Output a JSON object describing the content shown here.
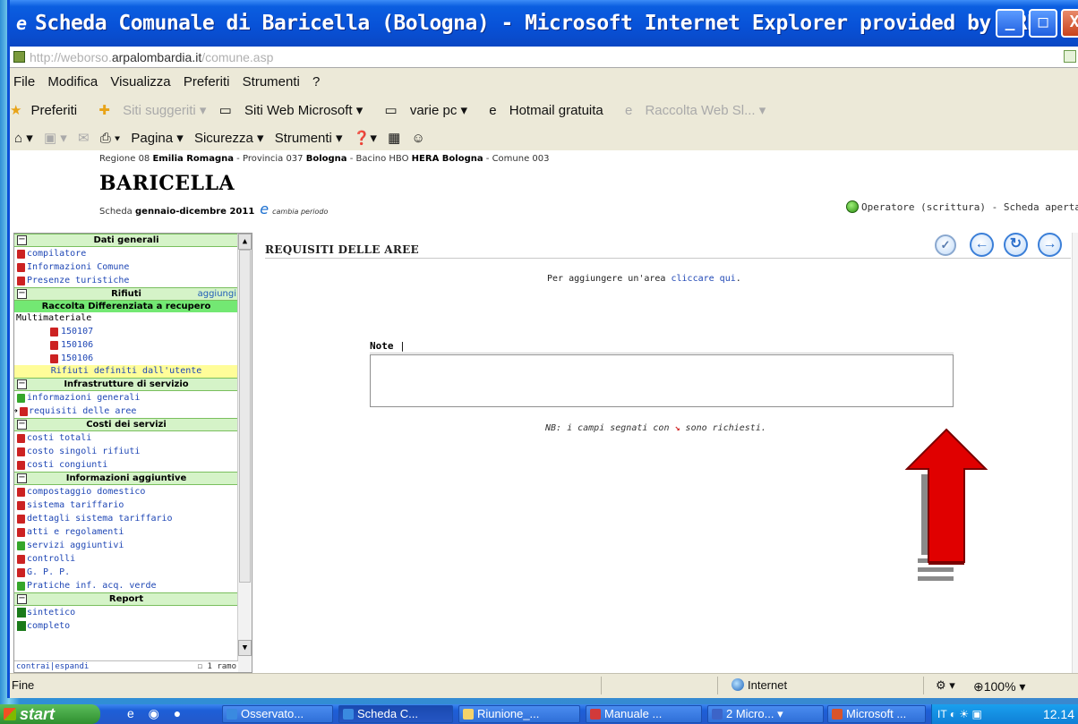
{
  "window": {
    "title": "Scheda Comunale di Baricella (Bologna) - Microsoft Internet Explorer provided by ARPA",
    "min_label": "_",
    "max_label": "□",
    "close_label": "X"
  },
  "address": {
    "url_prefix": "http://weborso.",
    "url_domain": "arpalombardia.it",
    "url_path": "/comune.asp"
  },
  "menu": [
    "File",
    "Modifica",
    "Visualizza",
    "Preferiti",
    "Strumenti",
    "?"
  ],
  "favorites": {
    "label": "Preferiti",
    "items": [
      "Siti suggeriti ▾",
      "Siti Web Microsoft ▾",
      "varie pc ▾",
      "Hotmail gratuita",
      "Raccolta Web Sl... ▾"
    ]
  },
  "commands": [
    "Pagina ▾",
    "Sicurezza ▾",
    "Strumenti ▾"
  ],
  "header": {
    "region_prefix": "Regione 08 ",
    "region_name": "Emilia Romagna",
    "province_prefix": " - Provincia 037 ",
    "province_name": "Bologna",
    "bacino_prefix": " - Bacino HBO ",
    "bacino_name": "HERA Bologna",
    "comune_suffix": " - Comune 003",
    "comune": "BARICELLA",
    "scheda_prefix": "Scheda ",
    "scheda_period": "gennaio-dicembre 2011",
    "cambia_periodo": "cambia periodo",
    "status": "Operatore (scrittura) - Scheda aperta"
  },
  "tree": {
    "dati_generali": "Dati generali",
    "dati_items": [
      "compilatore",
      "Informazioni Comune",
      "Presenze turistiche"
    ],
    "rifiuti": "Rifiuti",
    "aggiungi": "aggiungi",
    "raccolta": "Raccolta Differenziata a recupero",
    "multimateriale": "Multimateriale",
    "codes": [
      "150107",
      "150106",
      "150106"
    ],
    "rifiuti_utente": "Rifiuti definiti dall'utente",
    "infrastrutture": "Infrastrutture di servizio",
    "infra_items": [
      "informazioni generali",
      "requisiti delle aree"
    ],
    "costi": "Costi dei servizi",
    "costi_items": [
      "costi totali",
      "costo singoli rifiuti",
      "costi congiunti"
    ],
    "info_agg": "Informazioni aggiuntive",
    "info_items": [
      "compostaggio domestico",
      "sistema tariffario",
      "dettagli sistema tariffario",
      "atti e regolamenti",
      "servizi aggiuntivi",
      "controlli",
      "G. P. P.",
      "Pratiche inf. acq. verde"
    ],
    "report": "Report",
    "report_items": [
      "sintetico",
      "completo"
    ],
    "footer_left": "contrai|espandi",
    "footer_right": "1 ramo"
  },
  "main": {
    "title": "REQUISITI DELLE AREE",
    "add_text": "Per aggiungere un'area ",
    "add_link": "cliccare qui",
    "note_label": "Note",
    "nb_prefix": "NB: i campi segnati con ",
    "nb_suffix": " sono richiesti."
  },
  "status": {
    "left": "Fine",
    "zone": "Internet",
    "zoom": "100%"
  },
  "taskbar": {
    "start": "start",
    "tasks": [
      "Osservato...",
      "Scheda C...",
      "Riunione_...",
      "Manuale ...",
      "2 Micro... ▾",
      "Microsoft ..."
    ],
    "tray_lang": "IT",
    "clock": "12.14"
  },
  "colors": {
    "accent": "#0852d8",
    "section_green": "#d5f3c8",
    "raccolta_green": "#73e873",
    "highlight_yellow": "#fffd99",
    "arrow_red": "#e00000"
  }
}
